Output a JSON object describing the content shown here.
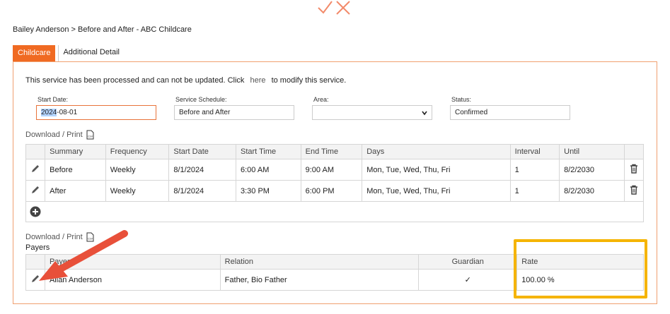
{
  "breadcrumb": "Bailey Anderson > Before and After - ABC Childcare",
  "tabs": [
    {
      "label": "Childcare",
      "active": true
    },
    {
      "label": "Additional Detail",
      "active": false
    }
  ],
  "notice": {
    "prefix": "This service has been processed and can not be updated. Click",
    "link": "here",
    "suffix": "to modify this service."
  },
  "fields": {
    "start_date": {
      "label": "Start Date:",
      "value_selected": "2024",
      "value_rest": "-08-01"
    },
    "service_schedule": {
      "label": "Service Schedule:",
      "value": "Before and After"
    },
    "area": {
      "label": "Area:",
      "value": ""
    },
    "status": {
      "label": "Status:",
      "value": "Confirmed"
    }
  },
  "download_label": "Download / Print",
  "schedule_table": {
    "headers": [
      "Summary",
      "Frequency",
      "Start Date",
      "Start Time",
      "End Time",
      "Days",
      "Interval",
      "Until"
    ],
    "rows": [
      {
        "summary": "Before",
        "frequency": "Weekly",
        "start_date": "8/1/2024",
        "start_time": "6:00 AM",
        "end_time": "9:00 AM",
        "days": "Mon, Tue, Wed, Thu, Fri",
        "interval": "1",
        "until": "8/2/2030"
      },
      {
        "summary": "After",
        "frequency": "Weekly",
        "start_date": "8/1/2024",
        "start_time": "3:30 PM",
        "end_time": "6:00 PM",
        "days": "Mon, Tue, Wed, Thu, Fri",
        "interval": "1",
        "until": "8/2/2030"
      }
    ]
  },
  "payers": {
    "label": "Payers",
    "headers": {
      "payer": "Payer",
      "relation": "Relation",
      "guardian": "Guardian",
      "rate": "Rate"
    },
    "rows": [
      {
        "payer": "Allan Anderson",
        "relation": "Father, Bio Father",
        "guardian": "✓",
        "rate": "100.00 %"
      }
    ]
  },
  "colors": {
    "accent": "#f06a22",
    "highlight": "#f5b400",
    "annotation_arrow": "#e8503a"
  },
  "icons": [
    "logo-check-x-icon",
    "csv-icon",
    "pencil-icon",
    "trash-icon",
    "plus-circle-icon",
    "chevron-down-icon",
    "checkmark-icon"
  ]
}
